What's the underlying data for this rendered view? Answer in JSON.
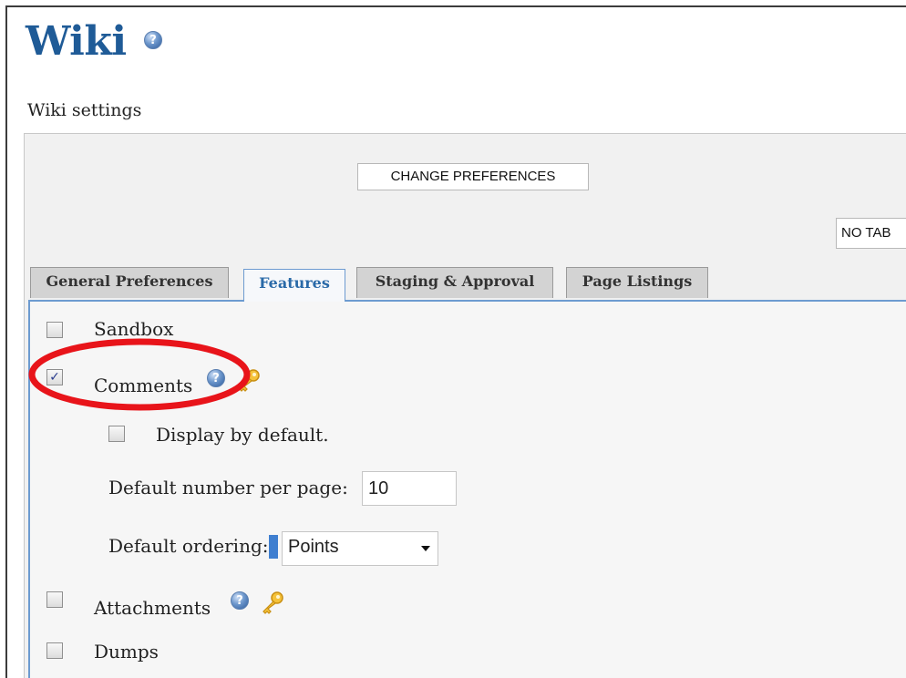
{
  "header": {
    "title": "Wiki",
    "subtitle": "Wiki settings"
  },
  "toolbar": {
    "change_preferences_label": "CHANGE PREFERENCES",
    "no_tab_label": "NO TAB"
  },
  "tabs": [
    {
      "label": "General Preferences",
      "active": false
    },
    {
      "label": "Features",
      "active": true
    },
    {
      "label": "Staging & Approval",
      "active": false
    },
    {
      "label": "Page Listings",
      "active": false
    }
  ],
  "features": {
    "sandbox": {
      "label": "Sandbox",
      "checked": false
    },
    "comments": {
      "label": "Comments",
      "checked": true,
      "display_by_default": {
        "label": "Display by default.",
        "checked": false
      },
      "per_page": {
        "label": "Default number per page:",
        "value": "10"
      },
      "ordering": {
        "label": "Default ordering:",
        "value": "Points"
      }
    },
    "attachments": {
      "label": "Attachments",
      "checked": false
    },
    "dumps": {
      "label": "Dumps",
      "checked": false
    }
  },
  "icons": {
    "help": "help-icon",
    "key": "key-icon",
    "highlight_color": "#e8141a"
  }
}
